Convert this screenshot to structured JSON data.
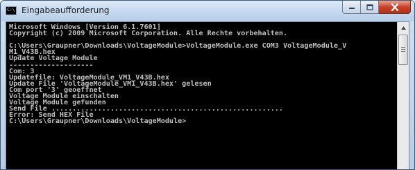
{
  "window": {
    "title": "Eingabeaufforderung",
    "icon": "cmd-icon",
    "controls": [
      "minimize-icon",
      "maximize-icon",
      "close-icon"
    ]
  },
  "console": {
    "lines": [
      "Microsoft Windows [Version 6.1.7601]",
      "Copyright (c) 2009 Microsoft Corporation. Alle Rechte vorbehalten.",
      "",
      "C:\\Users\\Graupner\\Downloads\\VoltageModule>VoltageModule.exe COM3 VoltageModule_V",
      "M1_V43B.hex",
      "Update Voltage Module",
      "--------------------",
      "Com: 3",
      "Updatefile: VoltageModule_VM1_V43B.hex",
      "Update File 'VoltageModule_VM1_V43B.hex' gelesen",
      "Com port '3' geoeffnet",
      "Voltage Module einschalten",
      "Voltage Module gefunden",
      "Send File .......................................................",
      "Error: Send HEX File",
      "C:\\Users\\Graupner\\Downloads\\VoltageModule>"
    ]
  },
  "colors": {
    "console_bg": "#000000",
    "console_text": "#c0c0c0",
    "titlebar": "#c4d8ee",
    "close_button": "#c7442c"
  }
}
